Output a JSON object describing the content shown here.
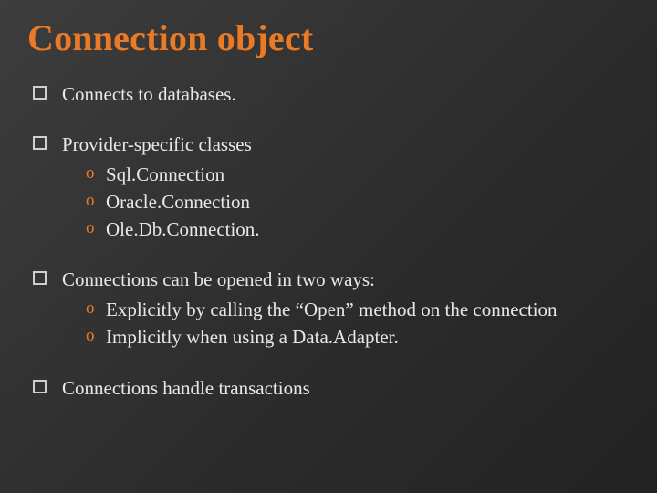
{
  "title": "Connection object",
  "bullets": [
    {
      "text": "Connects to databases.",
      "sub": []
    },
    {
      "text": "Provider-specific classes",
      "sub": [
        "Sql.Connection",
        "Oracle.Connection",
        "Ole.Db.Connection."
      ]
    },
    {
      "text": "Connections can be opened in two ways:",
      "sub": [
        "Explicitly by calling the “Open” method on the connection",
        "Implicitly when using a Data.Adapter."
      ]
    },
    {
      "text": "Connections handle transactions",
      "sub": []
    }
  ]
}
